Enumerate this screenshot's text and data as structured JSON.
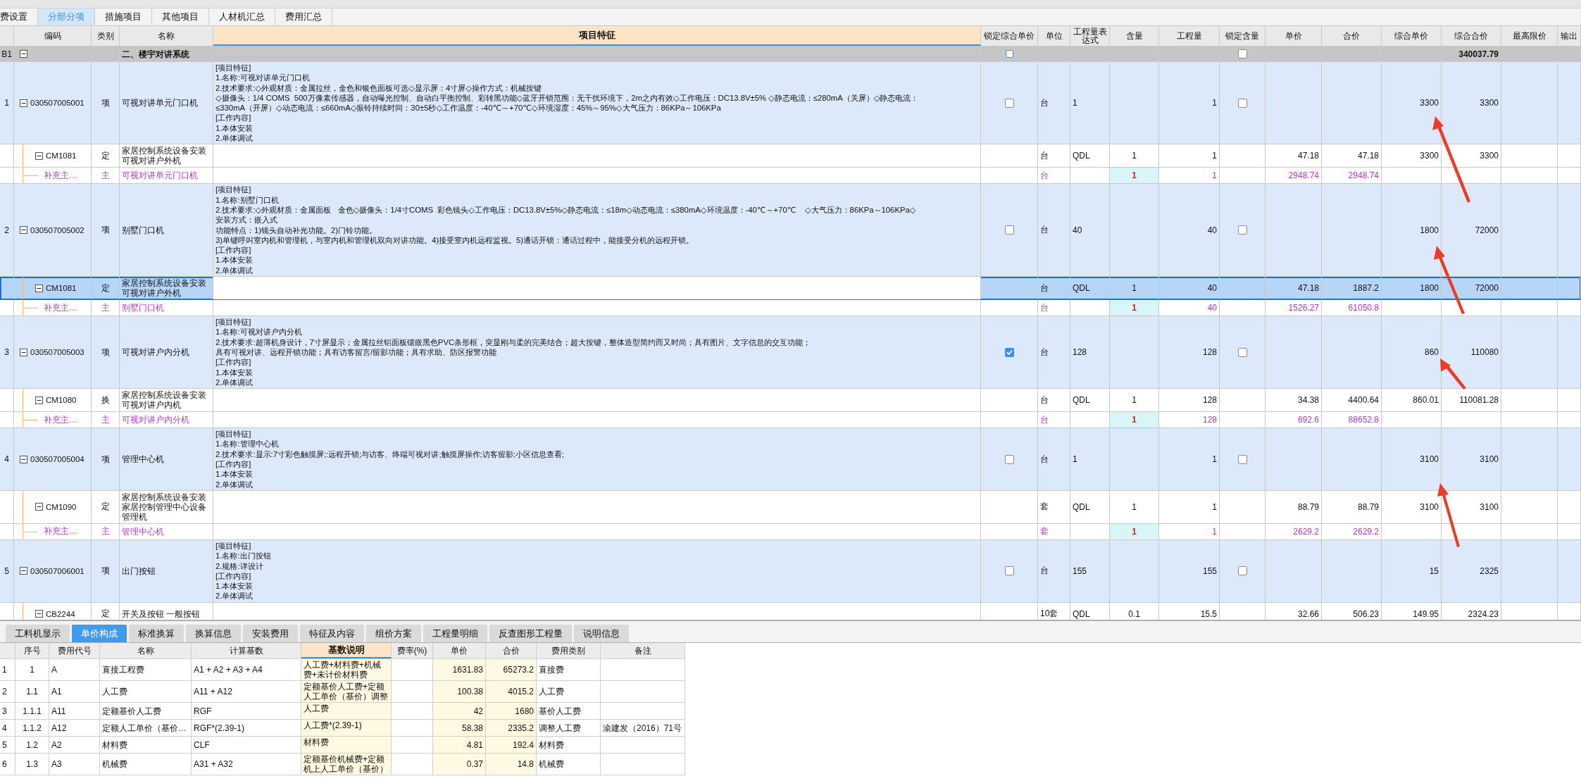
{
  "tabs": [
    {
      "label": "费设置",
      "selected": false
    },
    {
      "label": "分部分项",
      "selected": true
    },
    {
      "label": "措施项目",
      "selected": false
    },
    {
      "label": "其他项目",
      "selected": false
    },
    {
      "label": "人材机汇总",
      "selected": false
    },
    {
      "label": "费用汇总",
      "selected": false
    }
  ],
  "table": {
    "columns": [
      "编码",
      "类别",
      "名称",
      "项目特征",
      "锁定综合单价",
      "单位",
      "工程量表达式",
      "含量",
      "工程量",
      "锁定含量",
      "单价",
      "合价",
      "综合单价",
      "综合合价",
      "最高限价",
      "输出"
    ],
    "rows": [
      {
        "kind": "group",
        "selected": false,
        "row_label": "B1",
        "expanded": true,
        "name": "二、楼宇对讲系统",
        "lock_price": false,
        "lock_content": false,
        "composite_total": "340037.79"
      },
      {
        "kind": "item",
        "selected": false,
        "row_label": "1",
        "expanded": true,
        "code": "030507005001",
        "type": "项",
        "name": "可视对讲单元门口机",
        "features": [
          "[项目特征]",
          "1.名称:可视对讲单元门口机",
          "2.技术要求:◇外观材质：金属拉丝，金色和银色面板可选◇显示屏：4寸屏◇操作方式：机械按键",
          "◇摄像头：1/4 COMS  500万像素传感器，自动曝光控制、自动白平衡控制、彩转黑功能◇蓝牙开锁范围：无干扰环境下，2m之内有效◇工作电压：DC13.8V±5% ◇静态电流：≤280mA（关屏）◇静态电流：",
          "≤330mA（开屏）◇动态电流：≤660mA◇振铃持续时间：30±5秒◇工作温度：-40℃～+70℃◇环境湿度：45%～95%◇大气压力：86KPa～106KPa",
          "[工作内容]",
          "1.本体安装",
          "2.单体调试"
        ],
        "lock_price": false,
        "unit": "台",
        "qty_expr": "1",
        "quantity": "1",
        "lock_content": false,
        "composite_price": "3300",
        "composite_total": "3300"
      },
      {
        "kind": "quota",
        "selected": false,
        "expanded": true,
        "code": "CM1081",
        "type": "定",
        "name": "家居控制系统设备安装可视对讲户外机",
        "unit": "台",
        "qty_expr": "QDL",
        "content": "1",
        "quantity": "1",
        "unit_price": "47.18",
        "total_price": "47.18",
        "composite_price": "3300",
        "composite_total": "3300"
      },
      {
        "kind": "material",
        "selected": false,
        "code": "补充主…",
        "type": "主",
        "name": "可视对讲单元门口机",
        "unit": "台",
        "content": "1",
        "quantity": "1",
        "unit_price": "2948.74",
        "total_price": "2948.74"
      },
      {
        "kind": "item",
        "selected": false,
        "row_label": "2",
        "expanded": true,
        "code": "030507005002",
        "type": "项",
        "name": "别墅门口机",
        "features": [
          "[项目特征]",
          "1.名称:别墅门口机",
          "2.技术要求:◇外观材质：金属面板   金色◇摄像头：1/4寸COMS  彩色镜头◇工作电压：DC13.8V±5%◇静态电流：≤18m◇动态电流：≤380mA◇环境温度：-40℃～+70℃    ◇大气压力：86KPa～106KPa◇",
          "安装方式：嵌入式",
          "功能特点：1)镜头自动补光功能。2)门铃功能。",
          "3)单键呼叫室内机和管理机，与室内机和管理机双向对讲功能。4)接受室内机远程监视。5)通话开锁：通话过程中，能接受分机的远程开锁。",
          "[工作内容]",
          "1.本体安装",
          "2.单体调试"
        ],
        "lock_price": false,
        "unit": "台",
        "qty_expr": "40",
        "quantity": "40",
        "lock_content": false,
        "composite_price": "1800",
        "composite_total": "72000"
      },
      {
        "kind": "quota",
        "selected": true,
        "expanded": true,
        "code": "CM1081",
        "type": "定",
        "name": "家居控制系统设备安装可视对讲户外机",
        "unit": "台",
        "qty_expr": "QDL",
        "content": "1",
        "quantity": "40",
        "unit_price": "47.18",
        "total_price": "1887.2",
        "composite_price": "1800",
        "composite_total": "72000"
      },
      {
        "kind": "material",
        "selected": false,
        "code": "补充主…",
        "type": "主",
        "name": "别墅门口机",
        "unit": "台",
        "content": "1",
        "quantity": "40",
        "unit_price": "1526.27",
        "total_price": "61050.8"
      },
      {
        "kind": "item",
        "selected": false,
        "row_label": "3",
        "expanded": true,
        "code": "030507005003",
        "type": "项",
        "name": "可视对讲户内分机",
        "features": [
          "[项目特征]",
          "1.名称:可视对讲户内分机",
          "2.技术要求:超薄机身设计，7寸屏显示；金属拉丝铝面板镶嵌黑色PVC条形框，突显刚与柔的完美结合；超大按键，整体造型简约而又时尚；具有图片、文字信息的交互功能；",
          "具有可视对讲、远程开锁功能；具有访客留言/留影功能；具有求助、防区报警功能",
          "[工作内容]",
          "1.本体安装",
          "2.单体调试"
        ],
        "lock_price": true,
        "unit": "台",
        "qty_expr": "128",
        "quantity": "128",
        "lock_content": false,
        "composite_price": "860",
        "composite_total": "110080"
      },
      {
        "kind": "quota",
        "selected": false,
        "expanded": true,
        "code": "CM1080",
        "type": "换",
        "name": "家居控制系统设备安装可视对讲户内机",
        "unit": "台",
        "qty_expr": "QDL",
        "content": "1",
        "quantity": "128",
        "unit_price": "34.38",
        "total_price": "4400.64",
        "composite_price": "860.01",
        "composite_total": "110081.28"
      },
      {
        "kind": "material",
        "selected": false,
        "code": "补充主…",
        "type": "主",
        "name": "可视对讲户内分机",
        "unit": "台",
        "content": "1",
        "quantity": "128",
        "unit_price": "692.6",
        "total_price": "88652.8"
      },
      {
        "kind": "item",
        "selected": false,
        "row_label": "4",
        "expanded": true,
        "code": "030507005004",
        "type": "项",
        "name": "管理中心机",
        "features": [
          "[项目特征]",
          "1.名称:管理中心机",
          "2.技术要求:显示:7寸彩色触摸屏;:远程开锁;与访客、终端可视对讲;触摸屏操作;访客留影;小区信息查看;",
          "[工作内容]",
          "1.本体安装",
          "2.单体调试"
        ],
        "lock_price": false,
        "unit": "台",
        "qty_expr": "1",
        "quantity": "1",
        "lock_content": false,
        "composite_price": "3100",
        "composite_total": "3100"
      },
      {
        "kind": "quota",
        "selected": false,
        "expanded": true,
        "code": "CM1090",
        "type": "定",
        "name": "家居控制系统设备安装家居控制管理中心设备管理机",
        "unit": "套",
        "qty_expr": "QDL",
        "content": "1",
        "quantity": "1",
        "unit_price": "88.79",
        "total_price": "88.79",
        "composite_price": "3100",
        "composite_total": "3100"
      },
      {
        "kind": "material",
        "selected": false,
        "code": "补充主…",
        "type": "主",
        "name": "管理中心机",
        "unit": "套",
        "content": "1",
        "quantity": "1",
        "unit_price": "2629.2",
        "total_price": "2629.2"
      },
      {
        "kind": "item",
        "selected": false,
        "row_label": "5",
        "expanded": true,
        "code": "030507006001",
        "type": "项",
        "name": "出门按钮",
        "features": [
          "[项目特征]",
          "1.名称:出门按钮",
          "2.规格:详设计",
          "[工作内容]",
          "1.本体安装",
          "2.单体调试"
        ],
        "lock_price": false,
        "unit": "台",
        "qty_expr": "155",
        "quantity": "155",
        "lock_content": false,
        "composite_price": "15",
        "composite_total": "2325"
      },
      {
        "kind": "quota",
        "selected": false,
        "expanded": true,
        "code": "CB2244",
        "type": "定",
        "name": "开关及按钮 一般按钮",
        "unit": "10套",
        "qty_expr": "QDL",
        "content": "0.1",
        "quantity": "15.5",
        "unit_price": "32.66",
        "total_price": "506.23",
        "composite_price": "149.95",
        "composite_total": "2324.23"
      }
    ]
  },
  "detail_tabs": [
    {
      "label": "工料机显示",
      "selected": false
    },
    {
      "label": "单价构成",
      "selected": true
    },
    {
      "label": "标准换算",
      "selected": false
    },
    {
      "label": "换算信息",
      "selected": false
    },
    {
      "label": "安装费用",
      "selected": false
    },
    {
      "label": "特征及内容",
      "selected": false
    },
    {
      "label": "组价方案",
      "selected": false
    },
    {
      "label": "工程量明细",
      "selected": false
    },
    {
      "label": "反查图形工程量",
      "selected": false
    },
    {
      "label": "说明信息",
      "selected": false
    }
  ],
  "detail_table": {
    "columns": [
      "序号",
      "费用代号",
      "名称",
      "计算基数",
      "基数说明",
      "费率(%)",
      "单价",
      "合价",
      "费用类别",
      "备注"
    ],
    "rows": [
      {
        "row_label": "1",
        "seq": "1",
        "code": "A",
        "name": "直接工程费",
        "base": "A1 + A2 + A3 + A4",
        "base_desc": "人工费+材料费+机械费+未计价材料费",
        "unit_price": "1631.83",
        "total": "65273.2",
        "category": "直接费"
      },
      {
        "row_label": "2",
        "seq": "1.1",
        "code": "A1",
        "name": "人工费",
        "base": "A11 + A12",
        "base_desc": "定额基价人工费+定额人工单价（基价）调整",
        "unit_price": "100.38",
        "total": "4015.2",
        "category": "人工费"
      },
      {
        "row_label": "3",
        "seq": "1.1.1",
        "code": "A11",
        "name": "定额基价人工费",
        "base": "RGF",
        "base_desc": "人工费",
        "unit_price": "42",
        "total": "1680",
        "category": "基价人工费"
      },
      {
        "row_label": "4",
        "seq": "1.1.2",
        "code": "A12",
        "name": "定额人工单价（基价…",
        "base": "RGF*(2.39-1)",
        "base_desc": "人工费*(2.39-1)",
        "unit_price": "58.38",
        "total": "2335.2",
        "category": "调整人工费",
        "note": "渝建发（2016）71号"
      },
      {
        "row_label": "5",
        "seq": "1.2",
        "code": "A2",
        "name": "材料费",
        "base": "CLF",
        "base_desc": "材料费",
        "unit_price": "4.81",
        "total": "192.4",
        "category": "材料费"
      },
      {
        "row_label": "6",
        "seq": "1.3",
        "code": "A3",
        "name": "机械费",
        "base": "A31 + A32",
        "base_desc": "定额基价机械费+定额机上人工单价（基价）",
        "unit_price": "0.37",
        "total": "14.8",
        "category": "机械费"
      }
    ]
  }
}
